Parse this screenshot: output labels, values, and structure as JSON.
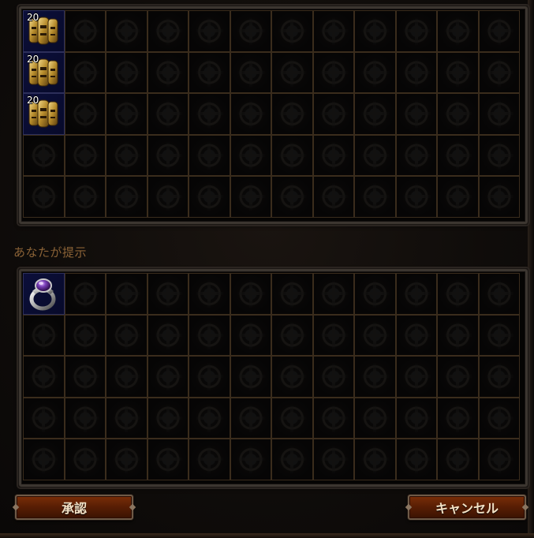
{
  "their_offer": {
    "items": [
      {
        "type": "portal-scroll-stack",
        "stack_count": "20",
        "row": 0,
        "col": 0
      },
      {
        "type": "portal-scroll-stack",
        "stack_count": "20",
        "row": 1,
        "col": 0
      },
      {
        "type": "portal-scroll-stack",
        "stack_count": "20",
        "row": 2,
        "col": 0
      }
    ]
  },
  "your_offer": {
    "label": "あなたが提示",
    "items": [
      {
        "type": "amethyst-ring",
        "row": 0,
        "col": 0
      }
    ]
  },
  "buttons": {
    "accept": "承認",
    "cancel": "キャンセル"
  },
  "colors": {
    "label": "#8a6236",
    "button_text": "#f4e2c6",
    "occupied_cell": "#0c0f3a",
    "grid_line": "#3a2c1c"
  }
}
